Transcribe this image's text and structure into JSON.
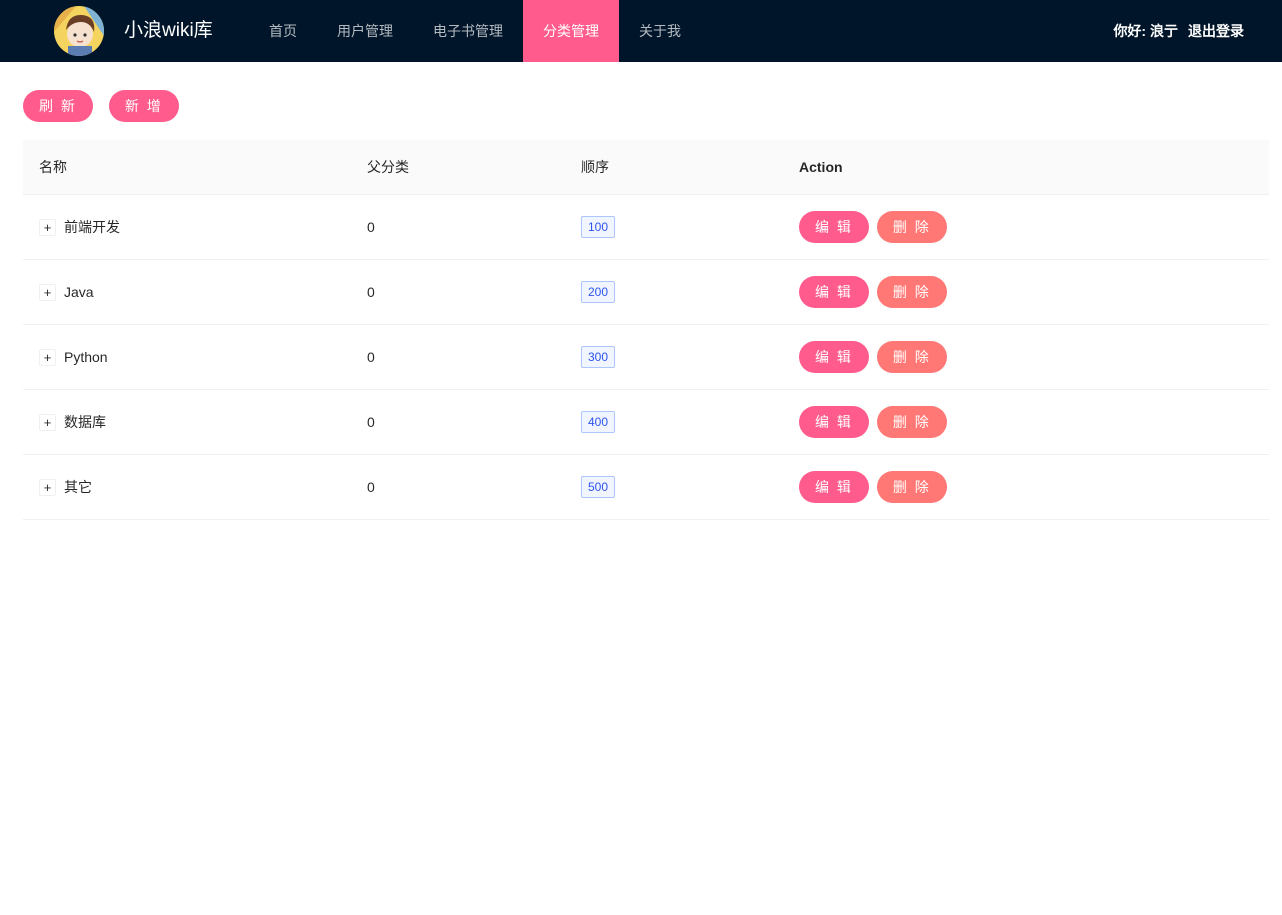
{
  "header": {
    "site_title": "小浪wiki库",
    "nav": [
      {
        "label": "首页",
        "active": false
      },
      {
        "label": "用户管理",
        "active": false
      },
      {
        "label": "电子书管理",
        "active": false
      },
      {
        "label": "分类管理",
        "active": true
      },
      {
        "label": "关于我",
        "active": false
      }
    ],
    "greeting": "你好: 浪亍",
    "logout_label": "退出登录"
  },
  "toolbar": {
    "refresh_label": "刷 新",
    "add_label": "新 增"
  },
  "table": {
    "columns": [
      "名称",
      "父分类",
      "顺序",
      "Action"
    ],
    "rows": [
      {
        "expand": "+",
        "name": "前端开发",
        "parent": "0",
        "sort": "100",
        "edit": "编 辑",
        "delete": "删 除"
      },
      {
        "expand": "+",
        "name": "Java",
        "parent": "0",
        "sort": "200",
        "edit": "编 辑",
        "delete": "删 除"
      },
      {
        "expand": "+",
        "name": "Python",
        "parent": "0",
        "sort": "300",
        "edit": "编 辑",
        "delete": "删 除"
      },
      {
        "expand": "+",
        "name": "数据库",
        "parent": "0",
        "sort": "400",
        "edit": "编 辑",
        "delete": "删 除"
      },
      {
        "expand": "+",
        "name": "其它",
        "parent": "0",
        "sort": "500",
        "edit": "编 辑",
        "delete": "删 除"
      }
    ]
  },
  "colors": {
    "header_bg": "#001529",
    "accent": "#ff5c8d",
    "danger": "#ff7875",
    "tag_blue": "#2f54eb"
  }
}
